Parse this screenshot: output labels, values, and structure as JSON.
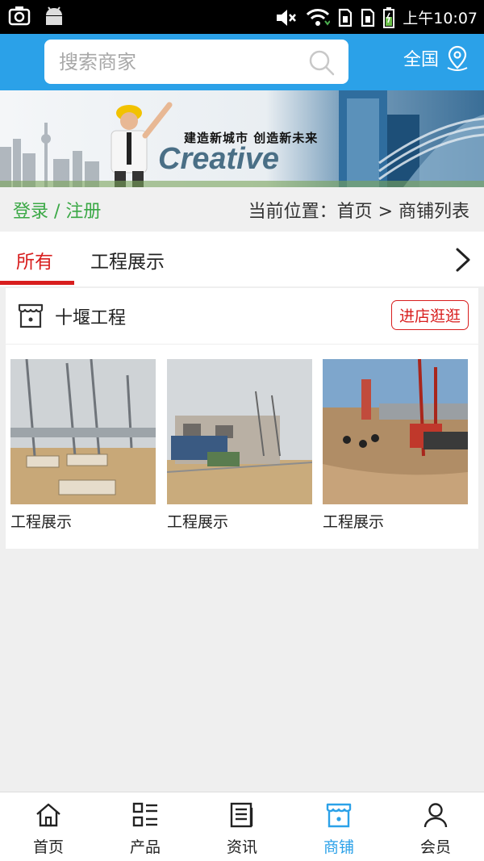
{
  "status_bar": {
    "time": "上午10:07",
    "icons": [
      "screenshot-icon",
      "android-icon",
      "mute-icon",
      "wifi-icon",
      "sim1-icon",
      "sim2-icon",
      "battery-icon"
    ]
  },
  "header": {
    "search_placeholder": "搜索商家",
    "region_label": "全国"
  },
  "banner": {
    "slogan": "建造新城市 创造新未来",
    "brand_text": "Creative"
  },
  "login_row": {
    "login_text": "登录 / 注册",
    "breadcrumb": "当前位置：首页 > 商铺列表"
  },
  "tabs": [
    {
      "label": "所有",
      "active": true
    },
    {
      "label": "工程展示",
      "active": false
    }
  ],
  "shop": {
    "name": "十堰工程",
    "visit_label": "进店逛逛",
    "products": [
      {
        "label": "工程展示"
      },
      {
        "label": "工程展示"
      },
      {
        "label": "工程展示"
      }
    ]
  },
  "bottom_nav": [
    {
      "label": "首页",
      "icon": "home-icon",
      "active": false
    },
    {
      "label": "产品",
      "icon": "grid-list-icon",
      "active": false
    },
    {
      "label": "资讯",
      "icon": "news-icon",
      "active": false
    },
    {
      "label": "商铺",
      "icon": "store-icon",
      "active": true
    },
    {
      "label": "会员",
      "icon": "user-icon",
      "active": false
    }
  ],
  "colors": {
    "brand_blue": "#2ba1e8",
    "accent_red": "#d81e1e",
    "login_green": "#3aa845"
  }
}
